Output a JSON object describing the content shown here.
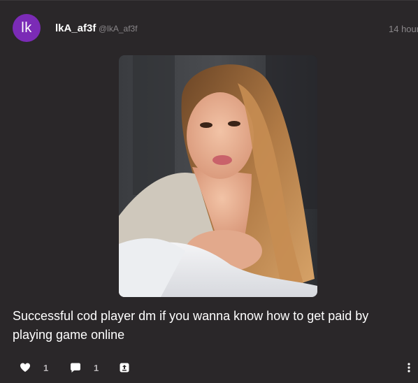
{
  "post": {
    "avatar_initials": "lk",
    "avatar_color": "#7b2bb6",
    "display_name": "lkA_af3f",
    "handle": "@lkA_af3f",
    "timestamp": "14 hour",
    "caption": "Successful cod player dm if you wanna know how to get paid by playing game online",
    "media_alt": "Selfie photo of a woman with long light-brown hair lying on a white pillow"
  },
  "actions": {
    "likes_icon": "heart-icon",
    "likes_count": "1",
    "comments_icon": "comment-icon",
    "comments_count": "1",
    "share_icon": "share-icon",
    "more_icon": "more-vertical-icon"
  }
}
